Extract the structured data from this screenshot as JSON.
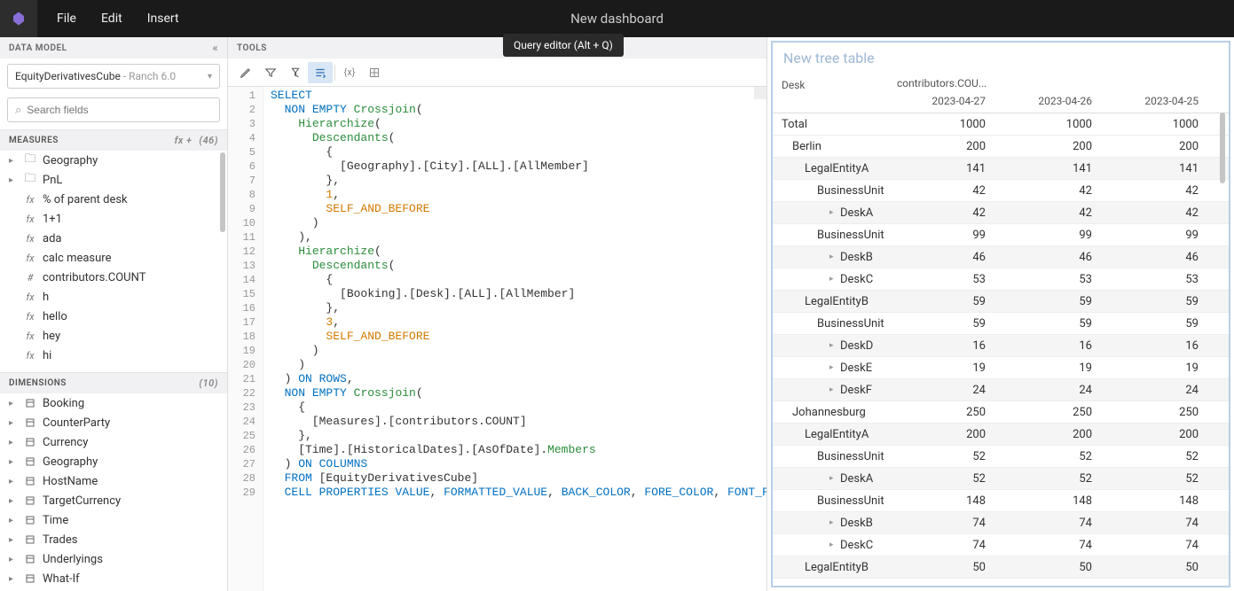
{
  "titlebar": {
    "title": "New dashboard",
    "menu": [
      "File",
      "Edit",
      "Insert"
    ]
  },
  "dataModel": {
    "header": "DATA MODEL",
    "cubeName": "EquityDerivativesCube",
    "cubeSub": " - Ranch 6.0",
    "searchPlaceholder": "Search fields"
  },
  "measures": {
    "header": "MEASURES",
    "count": "(46)",
    "items": [
      {
        "type": "folder",
        "label": "Geography"
      },
      {
        "type": "folder",
        "label": "PnL"
      },
      {
        "type": "fx",
        "label": "% of parent desk"
      },
      {
        "type": "fx",
        "label": "1+1"
      },
      {
        "type": "fx",
        "label": "ada"
      },
      {
        "type": "fx",
        "label": "calc measure"
      },
      {
        "type": "hash",
        "label": "contributors.COUNT"
      },
      {
        "type": "fx",
        "label": "h"
      },
      {
        "type": "fx",
        "label": "hello"
      },
      {
        "type": "fx",
        "label": "hey"
      },
      {
        "type": "fx",
        "label": "hi"
      }
    ]
  },
  "dimensions": {
    "header": "DIMENSIONS",
    "count": "(10)",
    "items": [
      "Booking",
      "CounterParty",
      "Currency",
      "Geography",
      "HostName",
      "TargetCurrency",
      "Time",
      "Trades",
      "Underlyings",
      "What-If"
    ]
  },
  "tools": {
    "header": "TOOLS",
    "tooltip": "Query editor (Alt + Q)"
  },
  "code": {
    "lines": [
      [
        {
          "t": "SELECT",
          "c": "kw"
        }
      ],
      [
        {
          "t": "  ",
          "c": ""
        },
        {
          "t": "NON EMPTY",
          "c": "kw"
        },
        {
          "t": " ",
          "c": ""
        },
        {
          "t": "Crossjoin",
          "c": "fn"
        },
        {
          "t": "(",
          "c": ""
        }
      ],
      [
        {
          "t": "    ",
          "c": ""
        },
        {
          "t": "Hierarchize",
          "c": "fn"
        },
        {
          "t": "(",
          "c": ""
        }
      ],
      [
        {
          "t": "      ",
          "c": ""
        },
        {
          "t": "Descendants",
          "c": "fn"
        },
        {
          "t": "(",
          "c": ""
        }
      ],
      [
        {
          "t": "        {",
          "c": ""
        }
      ],
      [
        {
          "t": "          [Geography].[City].[ALL].[AllMember]",
          "c": ""
        }
      ],
      [
        {
          "t": "        },",
          "c": ""
        }
      ],
      [
        {
          "t": "        ",
          "c": ""
        },
        {
          "t": "1",
          "c": "num"
        },
        {
          "t": ",",
          "c": ""
        }
      ],
      [
        {
          "t": "        ",
          "c": ""
        },
        {
          "t": "SELF_AND_BEFORE",
          "c": "op"
        }
      ],
      [
        {
          "t": "      )",
          "c": ""
        }
      ],
      [
        {
          "t": "    ),",
          "c": ""
        }
      ],
      [
        {
          "t": "    ",
          "c": ""
        },
        {
          "t": "Hierarchize",
          "c": "fn"
        },
        {
          "t": "(",
          "c": ""
        }
      ],
      [
        {
          "t": "      ",
          "c": ""
        },
        {
          "t": "Descendants",
          "c": "fn"
        },
        {
          "t": "(",
          "c": ""
        }
      ],
      [
        {
          "t": "        {",
          "c": ""
        }
      ],
      [
        {
          "t": "          [Booking].[Desk].[ALL].[AllMember]",
          "c": ""
        }
      ],
      [
        {
          "t": "        },",
          "c": ""
        }
      ],
      [
        {
          "t": "        ",
          "c": ""
        },
        {
          "t": "3",
          "c": "num"
        },
        {
          "t": ",",
          "c": ""
        }
      ],
      [
        {
          "t": "        ",
          "c": ""
        },
        {
          "t": "SELF_AND_BEFORE",
          "c": "op"
        }
      ],
      [
        {
          "t": "      )",
          "c": ""
        }
      ],
      [
        {
          "t": "    )",
          "c": ""
        }
      ],
      [
        {
          "t": "  ) ",
          "c": ""
        },
        {
          "t": "ON ROWS",
          "c": "kw"
        },
        {
          "t": ",",
          "c": ""
        }
      ],
      [
        {
          "t": "  ",
          "c": ""
        },
        {
          "t": "NON EMPTY",
          "c": "kw"
        },
        {
          "t": " ",
          "c": ""
        },
        {
          "t": "Crossjoin",
          "c": "fn"
        },
        {
          "t": "(",
          "c": ""
        }
      ],
      [
        {
          "t": "    {",
          "c": ""
        }
      ],
      [
        {
          "t": "      [Measures].[contributors.COUNT]",
          "c": ""
        }
      ],
      [
        {
          "t": "    },",
          "c": ""
        }
      ],
      [
        {
          "t": "    [Time].[HistoricalDates].[AsOfDate].",
          "c": ""
        },
        {
          "t": "Members",
          "c": "fn"
        }
      ],
      [
        {
          "t": "  ) ",
          "c": ""
        },
        {
          "t": "ON COLUMNS",
          "c": "kw"
        }
      ],
      [
        {
          "t": "  ",
          "c": ""
        },
        {
          "t": "FROM",
          "c": "kw"
        },
        {
          "t": " [EquityDerivativesCube]",
          "c": ""
        }
      ],
      [
        {
          "t": "  ",
          "c": ""
        },
        {
          "t": "CELL PROPERTIES",
          "c": "kw"
        },
        {
          "t": " ",
          "c": ""
        },
        {
          "t": "VALUE",
          "c": "prop"
        },
        {
          "t": ", ",
          "c": ""
        },
        {
          "t": "FORMATTED_VALUE",
          "c": "prop"
        },
        {
          "t": ", ",
          "c": ""
        },
        {
          "t": "BACK_COLOR",
          "c": "prop"
        },
        {
          "t": ", ",
          "c": ""
        },
        {
          "t": "FORE_COLOR",
          "c": "prop"
        },
        {
          "t": ", ",
          "c": ""
        },
        {
          "t": "FONT_FLAGS",
          "c": "prop"
        }
      ]
    ]
  },
  "widget": {
    "title": "New tree table",
    "rowHeader": "Desk",
    "colHeader": "contributors.COU...",
    "dates": [
      "2023-04-27",
      "2023-04-26",
      "2023-04-25"
    ],
    "rows": [
      {
        "label": "Total",
        "indent": 0,
        "vals": [
          1000,
          1000,
          1000
        ],
        "caret": false,
        "alt": false
      },
      {
        "label": "Berlin",
        "indent": 1,
        "vals": [
          200,
          200,
          200
        ],
        "caret": false,
        "alt": false
      },
      {
        "label": "LegalEntityA",
        "indent": 2,
        "vals": [
          141,
          141,
          141
        ],
        "caret": false,
        "alt": true
      },
      {
        "label": "BusinessUnit",
        "indent": 3,
        "vals": [
          42,
          42,
          42
        ],
        "caret": false,
        "alt": false
      },
      {
        "label": "DeskA",
        "indent": 4,
        "vals": [
          42,
          42,
          42
        ],
        "caret": true,
        "alt": true
      },
      {
        "label": "BusinessUnit",
        "indent": 3,
        "vals": [
          99,
          99,
          99
        ],
        "caret": false,
        "alt": false
      },
      {
        "label": "DeskB",
        "indent": 4,
        "vals": [
          46,
          46,
          46
        ],
        "caret": true,
        "alt": true
      },
      {
        "label": "DeskC",
        "indent": 4,
        "vals": [
          53,
          53,
          53
        ],
        "caret": true,
        "alt": false
      },
      {
        "label": "LegalEntityB",
        "indent": 2,
        "vals": [
          59,
          59,
          59
        ],
        "caret": false,
        "alt": true
      },
      {
        "label": "BusinessUnit",
        "indent": 3,
        "vals": [
          59,
          59,
          59
        ],
        "caret": false,
        "alt": false
      },
      {
        "label": "DeskD",
        "indent": 4,
        "vals": [
          16,
          16,
          16
        ],
        "caret": true,
        "alt": true
      },
      {
        "label": "DeskE",
        "indent": 4,
        "vals": [
          19,
          19,
          19
        ],
        "caret": true,
        "alt": false
      },
      {
        "label": "DeskF",
        "indent": 4,
        "vals": [
          24,
          24,
          24
        ],
        "caret": true,
        "alt": true
      },
      {
        "label": "Johannesburg",
        "indent": 1,
        "vals": [
          250,
          250,
          250
        ],
        "caret": false,
        "alt": false
      },
      {
        "label": "LegalEntityA",
        "indent": 2,
        "vals": [
          200,
          200,
          200
        ],
        "caret": false,
        "alt": true
      },
      {
        "label": "BusinessUnit",
        "indent": 3,
        "vals": [
          52,
          52,
          52
        ],
        "caret": false,
        "alt": false
      },
      {
        "label": "DeskA",
        "indent": 4,
        "vals": [
          52,
          52,
          52
        ],
        "caret": true,
        "alt": true
      },
      {
        "label": "BusinessUnit",
        "indent": 3,
        "vals": [
          148,
          148,
          148
        ],
        "caret": false,
        "alt": false
      },
      {
        "label": "DeskB",
        "indent": 4,
        "vals": [
          74,
          74,
          74
        ],
        "caret": true,
        "alt": true
      },
      {
        "label": "DeskC",
        "indent": 4,
        "vals": [
          74,
          74,
          74
        ],
        "caret": true,
        "alt": false
      },
      {
        "label": "LegalEntityB",
        "indent": 2,
        "vals": [
          50,
          50,
          50
        ],
        "caret": false,
        "alt": true
      }
    ]
  }
}
